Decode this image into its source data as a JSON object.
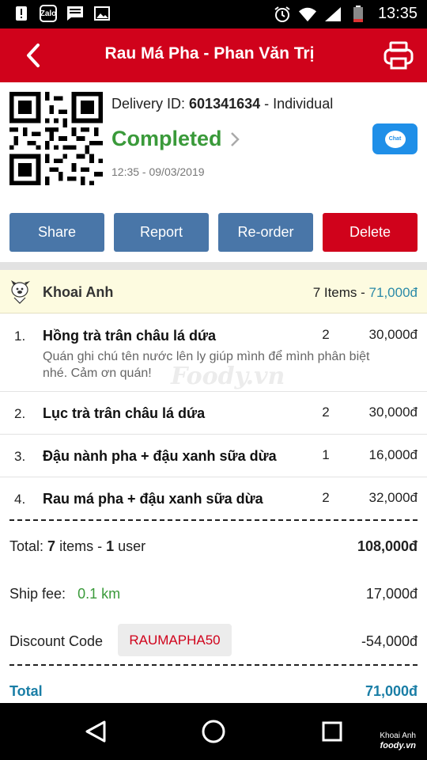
{
  "status_bar": {
    "time": "13:35",
    "zalo_label": "Zalo",
    "icons": [
      "alert-icon",
      "zalo-icon",
      "message-icon",
      "image-icon",
      "alarm-icon",
      "wifi-icon",
      "signal-icon",
      "battery-icon"
    ]
  },
  "header": {
    "title": "Rau Má Pha - Phan Văn Trị",
    "back_icon": "chevron-left-icon",
    "print_icon": "printer-icon"
  },
  "delivery": {
    "id_label": "Delivery ID:",
    "id": "601341634",
    "type": "- Individual",
    "status": "Completed",
    "datetime": "12:35 - 09/03/2019",
    "chat_label": "Chat"
  },
  "actions": {
    "share": "Share",
    "report": "Report",
    "reorder": "Re-order",
    "delete": "Delete"
  },
  "user": {
    "name": "Khoai Anh",
    "items_count": "7 Items -",
    "amount": "71,000đ"
  },
  "items": [
    {
      "index": "1.",
      "name": "Hồng trà trân châu lá dứa",
      "qty": "2",
      "price": "30,000đ",
      "note_line1": "Quán ghi chú tên nước lên ly giúp mình để mình phân biệt",
      "note_line2": "nhé. Cảm ơn quán!"
    },
    {
      "index": "2.",
      "name": "Lục trà trân châu lá dứa",
      "qty": "2",
      "price": "30,000đ"
    },
    {
      "index": "3.",
      "name": "Đậu nành pha + đậu xanh sữa dừa",
      "qty": "1",
      "price": "16,000đ"
    },
    {
      "index": "4.",
      "name": "Rau má pha + đậu xanh sữa dừa",
      "qty": "2",
      "price": "32,000đ"
    }
  ],
  "watermark": "Foody.vn",
  "summary": {
    "total_prefix": "Total:",
    "items_num": "7",
    "items_word": "items -",
    "users_num": "1",
    "users_word": "user",
    "subtotal": "108,000đ",
    "ship_label": "Ship fee:",
    "ship_distance": "0.1 km",
    "ship_fee": "17,000đ",
    "discount_label": "Discount Code",
    "discount_code": "RAUMAPHA50",
    "discount_value": "-54,000đ",
    "grand_total_label": "Total",
    "grand_total": "71,000đ"
  },
  "nav": {
    "owner": "Khoai Anh",
    "brand": "foody.vn"
  },
  "colors": {
    "brand_red": "#d0021b",
    "button_blue": "#4976a8",
    "status_green": "#3a9a3a",
    "total_blue": "#1a7ea6",
    "chat_blue": "#1f8fe8"
  }
}
